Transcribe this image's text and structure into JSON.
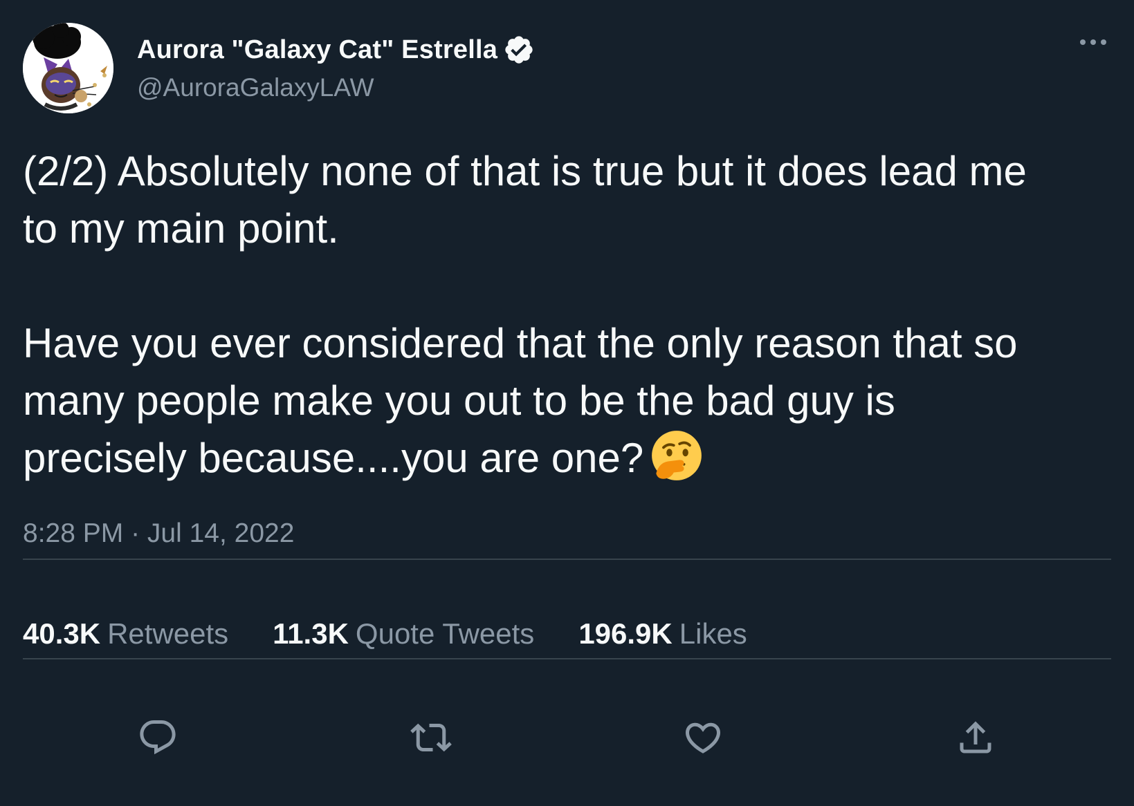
{
  "author": {
    "display_name": "Aurora \"Galaxy Cat\" Estrella",
    "handle": "@AuroraGalaxyLAW",
    "verified_icon": "verified-badge-icon",
    "avatar_icon": "cartoon-cat-woman-avatar"
  },
  "menu": {
    "more_icon": "more-horizontal-icon"
  },
  "tweet": {
    "paragraph_1_line_1": "(2/2) Absolutely none of that is true but it does lead me",
    "paragraph_1_line_2": "to my main point.",
    "paragraph_2_line_1": "Have you ever considered that the only reason that so",
    "paragraph_2_line_2": "many people make you out to be the bad guy is",
    "paragraph_2_line_3": "precisely because....you are one?",
    "emoji": "thinking-face-emoji",
    "timestamp": "8:28 PM · Jul 14, 2022"
  },
  "stats": {
    "retweets_count": "40.3K",
    "retweets_label": "Retweets",
    "quote_tweets_count": "11.3K",
    "quote_tweets_label": "Quote Tweets",
    "likes_count": "196.9K",
    "likes_label": "Likes"
  },
  "actions": {
    "reply_icon": "reply-icon",
    "retweet_icon": "retweet-icon",
    "like_icon": "heart-icon",
    "share_icon": "share-icon"
  },
  "colors": {
    "background": "#15202b",
    "primary_text": "#f7f9f9",
    "secondary_text": "#8b98a5",
    "divider": "#38444d",
    "emoji_yellow": "#ffcc4d"
  }
}
